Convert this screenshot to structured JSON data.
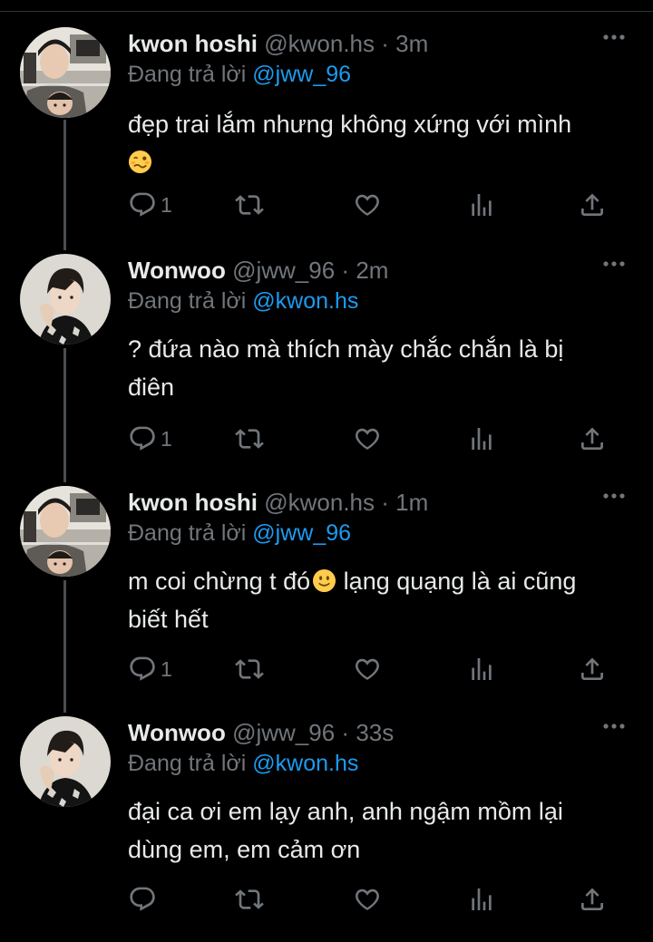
{
  "tweets": [
    {
      "name": "kwon hoshi",
      "handle": "@kwon.hs",
      "dot": "·",
      "time": "3m",
      "replying_prefix": "Đang trả lời",
      "replying_to": "@jww_96",
      "text_line1": "đẹp trai lắm nhưng không xứng với mình",
      "text_line2": "",
      "emoji": "woozy-face",
      "reply_count": "1"
    },
    {
      "name": "Wonwoo",
      "handle": "@jww_96",
      "dot": "·",
      "time": "2m",
      "replying_prefix": "Đang trả lời",
      "replying_to": "@kwon.hs",
      "text_line1": "? đứa nào mà thích mày chắc chắn là bị",
      "text_line2": "điên",
      "reply_count": "1"
    },
    {
      "name": "kwon hoshi",
      "handle": "@kwon.hs",
      "dot": "·",
      "time": "1m",
      "replying_prefix": "Đang trả lời",
      "replying_to": "@jww_96",
      "text_part1": "m coi chừng t đó",
      "emoji": "slightly-smiling-face",
      "text_part2": " lạng quạng là ai cũng",
      "text_line2": "biết hết",
      "reply_count": "1"
    },
    {
      "name": "Wonwoo",
      "handle": "@jww_96",
      "dot": "·",
      "time": "33s",
      "replying_prefix": "Đang trả lời",
      "replying_to": "@kwon.hs",
      "text_line1": "đại ca ơi em lạy anh, anh ngậm mồm lại",
      "text_line2": "dùng em, em cảm ơn",
      "reply_count": ""
    }
  ],
  "colors": {
    "background": "#000000",
    "text": "#e7e9ea",
    "muted": "#71767b",
    "mention": "#1d9bf0",
    "thread_line": "#4a4e52"
  },
  "icons": [
    "reply-icon",
    "retweet-icon",
    "like-icon",
    "views-icon",
    "share-icon",
    "more-icon"
  ]
}
